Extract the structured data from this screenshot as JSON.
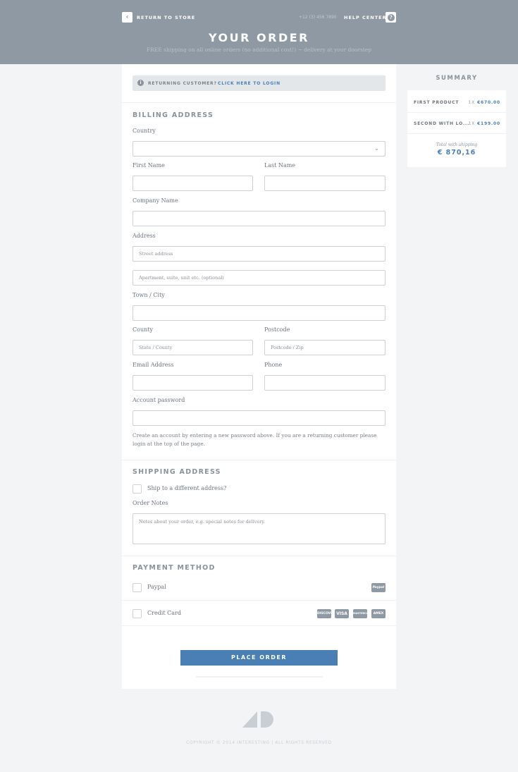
{
  "header": {
    "return_label": "RETURN TO STORE",
    "phone": "+12 (3) 456 7890",
    "help_label": "HELP CENTER",
    "title": "YOUR ORDER",
    "subtitle": "FREE shipping on all online orders (no additional cost!) ~ delivery at your doorstep"
  },
  "login": {
    "prefix": "RETURNING CUSTOMER?",
    "link": "CLICK HERE TO LOGIN"
  },
  "billing": {
    "heading": "BILLING ADDRESS",
    "country": "Country",
    "first_name": "First Name",
    "last_name": "Last Name",
    "company": "Company Name",
    "address": "Address",
    "street_placeholder": "Street address",
    "apt_placeholder": "Apartment, suite, unit etc. (optional)",
    "town": "Town / City",
    "county": "County",
    "county_placeholder": "State / County",
    "postcode": "Postcode",
    "postcode_placeholder": "Postcode / Zip",
    "email": "Email Address",
    "phone": "Phone",
    "password": "Account password",
    "help": "Create an account by entering a new password above. If you are a returning customer please login at the top of the page."
  },
  "shipping": {
    "heading": "SHIPPING ADDRESS",
    "different": "Ship to a different address?",
    "notes_label": "Order Notes",
    "notes_placeholder": "Notes about your order, e.g. special notes for delivery."
  },
  "payment": {
    "heading": "PAYMENT METHOD",
    "paypal": "Paypal",
    "paypal_badge": "Paypal",
    "credit": "Credit Card",
    "cards": [
      "DISCOVER",
      "VISA",
      "MASTERCARD",
      "AMEX"
    ],
    "place_order": "PLACE ORDER"
  },
  "summary": {
    "heading": "SUMMARY",
    "items": [
      {
        "name": "FIRST PRODUCT",
        "qty": "1X",
        "price": "€670.00"
      },
      {
        "name": "SECOND WITH LO...",
        "qty": "1X",
        "price": "€199.00"
      }
    ],
    "total_label": "Total with shipping",
    "total": "€ 870,16"
  },
  "footer": {
    "copyright": "COPYRIGHT © 2014 INTERESTING | ALL RIGHTS RESERVED"
  },
  "colors": {
    "header": "#8e99a4",
    "accent": "#4a7fb5"
  }
}
